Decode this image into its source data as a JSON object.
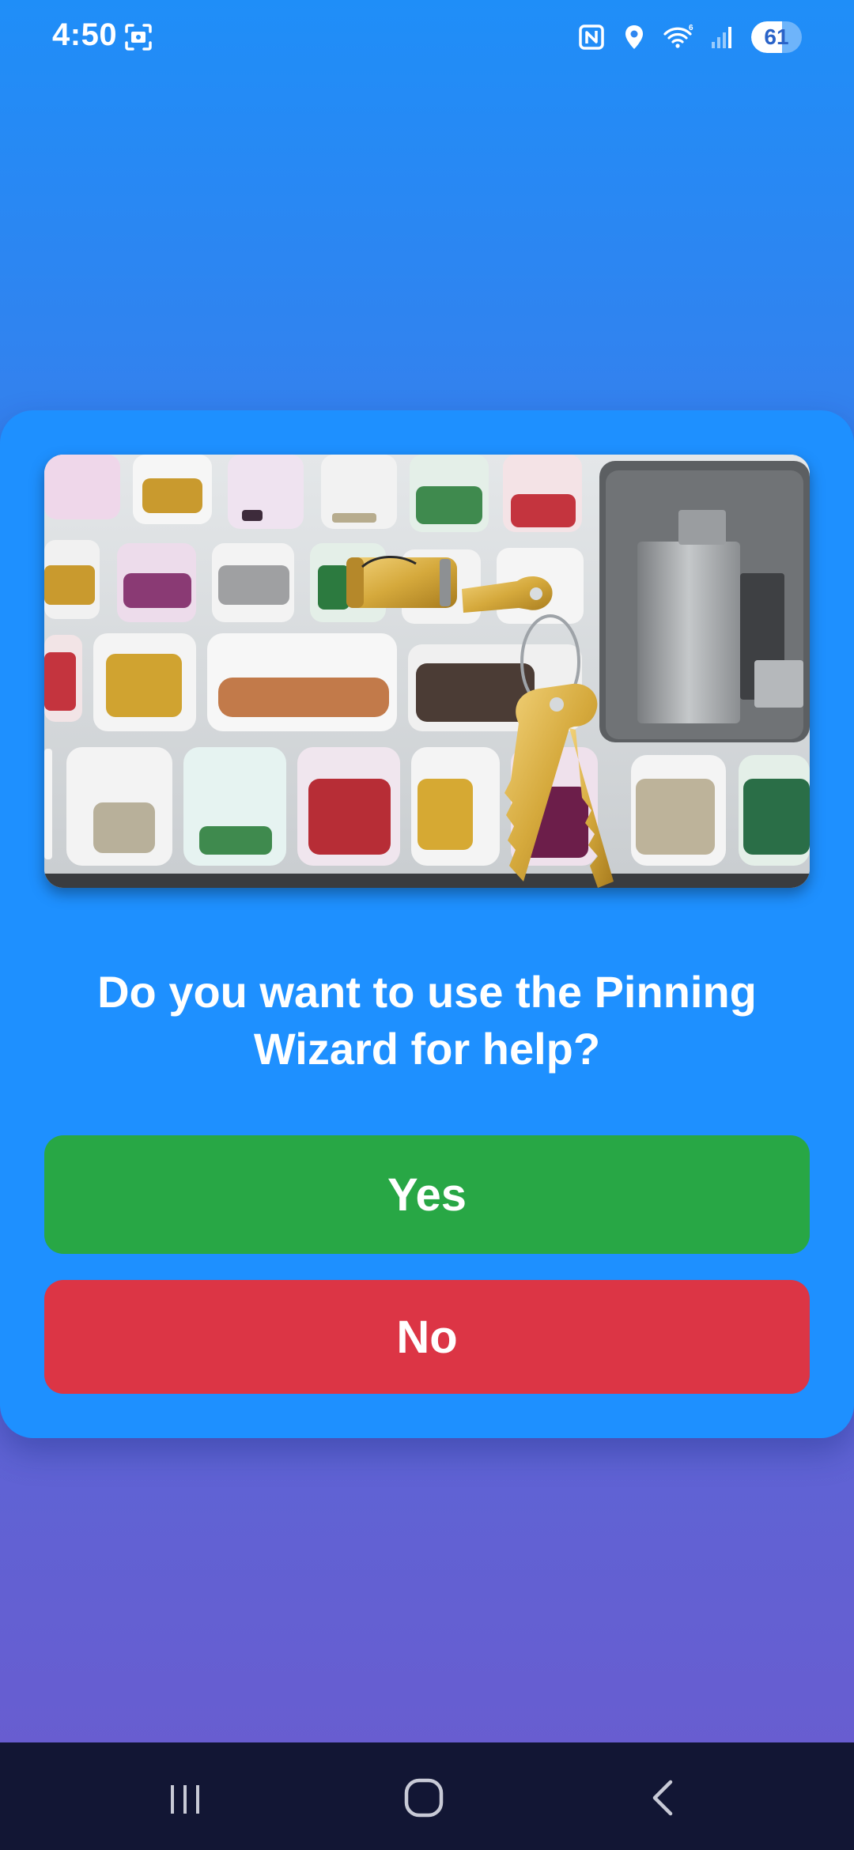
{
  "status_bar": {
    "time": "4:50",
    "battery_level": "61",
    "battery_fraction": 0.61,
    "icons": [
      "screenshot-icon",
      "nfc-icon",
      "location-icon",
      "wifi-icon",
      "signal-icon",
      "battery-icon"
    ]
  },
  "dialog": {
    "image_name": "lock-pinning-kit-photo",
    "question": "Do you want to use the Pinning Wizard for help?",
    "yes_label": "Yes",
    "no_label": "No"
  },
  "colors": {
    "background_top": "#1f8ef8",
    "background_bottom": "#6b5bcf",
    "card": "#1e90ff",
    "yes_button": "#28a745",
    "no_button": "#dc3545",
    "nav_bar": "#121634"
  },
  "nav_bar": {
    "icons": [
      "recents-icon",
      "home-icon",
      "back-icon"
    ]
  }
}
